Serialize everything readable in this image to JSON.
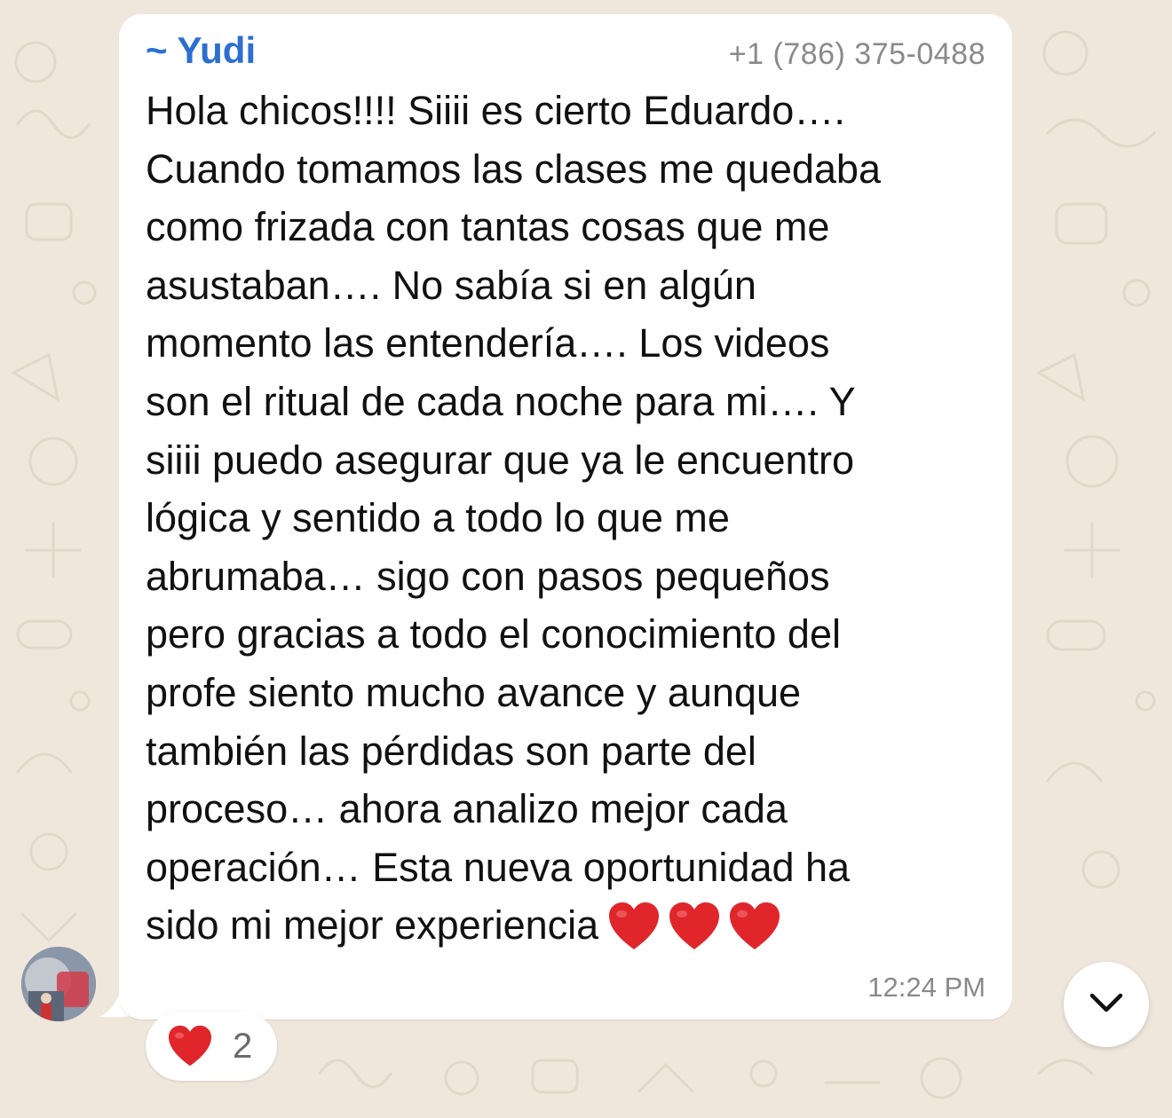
{
  "chat": {
    "message": {
      "sender_name": "~ Yudi",
      "sender_phone": "+1 (786) 375-0488",
      "text_lines": [
        "Hola chicos!!!! Siiii es cierto Eduardo….",
        "Cuando tomamos las clases me quedaba",
        "como frizada con tantas cosas que me",
        "asustaban…. No sabía si en algún",
        "momento las entendería…. Los videos",
        "son el ritual de cada noche para mi…. Y",
        "siiii puedo asegurar que ya le encuentro",
        "lógica y sentido a todo lo que me",
        "abrumaba… sigo con pasos pequeños",
        "pero gracias a todo el conocimiento del",
        "profe siento mucho avance y aunque",
        "también las pérdidas son parte del",
        "proceso… ahora analizo mejor cada",
        "operación… Esta nueva oportunidad ha",
        "sido mi mejor experiencia"
      ],
      "emoji": [
        "red-heart",
        "red-heart",
        "red-heart"
      ],
      "time": "12:24 PM"
    },
    "reaction": {
      "emoji": "red-heart",
      "count": "2"
    },
    "avatar": {
      "description_icon": "group-avatar"
    },
    "scroll_button": {
      "icon": "chevron-down-icon"
    },
    "colors": {
      "background": "#efe7dc",
      "bubble": "#ffffff",
      "sender_name": "#2c6fd1",
      "meta_text": "#8a8a8a",
      "heart": "#e0262b"
    }
  }
}
